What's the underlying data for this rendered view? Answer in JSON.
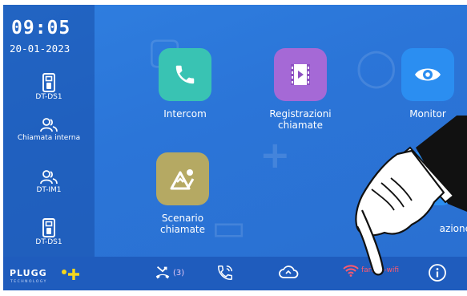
{
  "status": {
    "time": "09:05",
    "date": "20-01-2023"
  },
  "sidebar": {
    "items": [
      {
        "label": "DT-DS1",
        "icon": "door-phone-icon"
      },
      {
        "label": "Chiamata interna",
        "icon": "users-icon"
      },
      {
        "label": "DT-IM1",
        "icon": "users-icon"
      },
      {
        "label": "DT-DS1",
        "icon": "door-phone-icon"
      }
    ]
  },
  "apps": [
    {
      "label_lines": [
        "Intercom"
      ],
      "icon": "phone-icon",
      "color": "#39c3b3"
    },
    {
      "label_lines": [
        "Registrazioni",
        "chiamate"
      ],
      "icon": "film-play-icon",
      "color": "#a569d6"
    },
    {
      "label_lines": [
        "Monitor"
      ],
      "icon": "eye-icon",
      "color": "#2b8ef1"
    },
    {
      "label_lines": [
        "Scenario",
        "chiamate"
      ],
      "icon": "mountain-scenario-icon",
      "color": "#b5a963"
    },
    {
      "label_lines": [
        "azione"
      ],
      "icon": "settings-icon",
      "color": "#2b8ef1"
    }
  ],
  "bottombar": {
    "brand": "PLUGG",
    "brand_tagline": "TECHNOLOGY",
    "missed_calls_count": "(3)",
    "wifi_name": "farfisa-wifi",
    "wifi_color": "#ff5a6e",
    "accent": "#f4d71c"
  }
}
